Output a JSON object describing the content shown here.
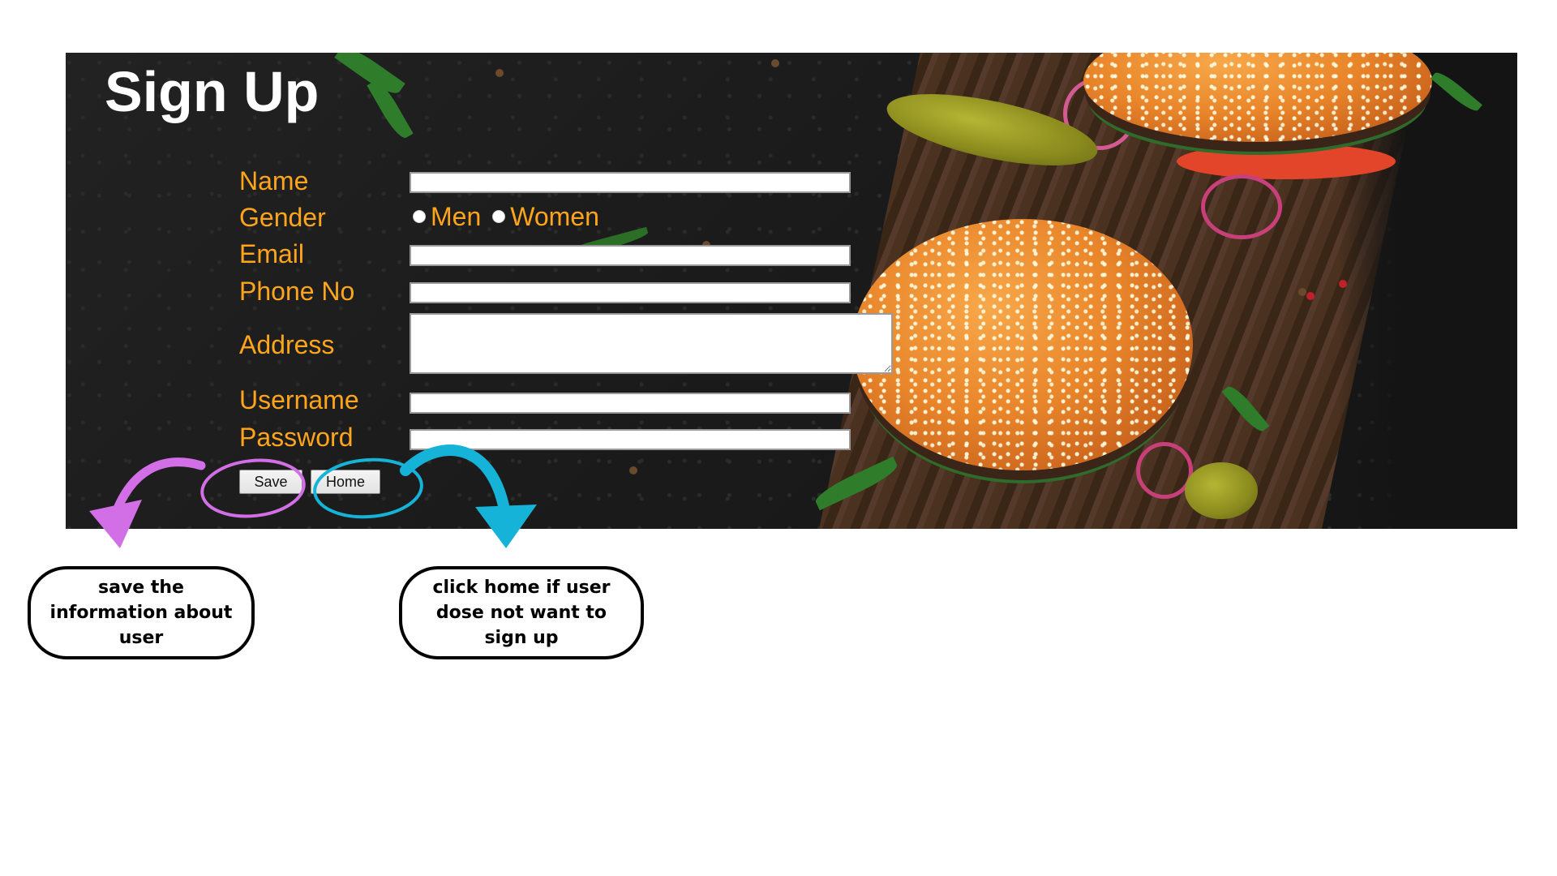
{
  "form": {
    "title": "Sign Up",
    "labels": {
      "name": "Name",
      "gender": "Gender",
      "email": "Email",
      "phone": "Phone No",
      "address": "Address",
      "username": "Username",
      "password": "Password"
    },
    "fields": {
      "name_value": "",
      "email_value": "",
      "phone_value": "",
      "address_value": "",
      "username_value": "",
      "password_value": ""
    },
    "gender_options": [
      "Men",
      "Women"
    ],
    "buttons": {
      "save_label": "Save",
      "home_label": "Home"
    }
  },
  "annotations": {
    "save_note": "save the information about user",
    "home_note": "click home if user dose not want to sign up",
    "save_color": "#d36fe6",
    "home_color": "#16b3d8"
  },
  "colors": {
    "label_orange": "#ffa51c",
    "title_white": "#ffffff"
  }
}
